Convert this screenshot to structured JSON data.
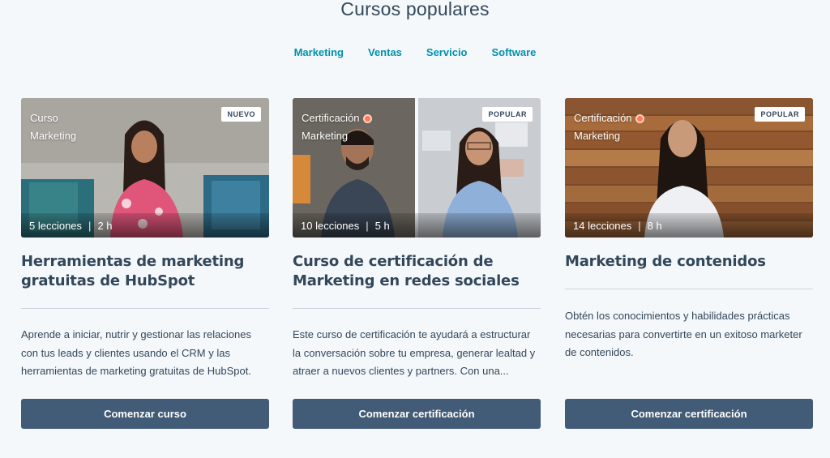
{
  "section": {
    "title": "Cursos populares"
  },
  "tabs": [
    {
      "label": "Marketing"
    },
    {
      "label": "Ventas"
    },
    {
      "label": "Servicio"
    },
    {
      "label": "Software"
    }
  ],
  "cards": [
    {
      "kind": "Curso",
      "category": "Marketing",
      "badge": "NUEVO",
      "lessons": "5 lecciones",
      "duration": "2 h",
      "title": "Herramientas de marketing gratuitas de HubSpot",
      "description": "Aprende a iniciar, nutrir y gestionar las relaciones con tus leads y clientes usando el CRM y las herramientas de marketing gratuitas de HubSpot.",
      "cta": "Comenzar curso"
    },
    {
      "kind": "Certificación",
      "category": "Marketing",
      "badge": "POPULAR",
      "lessons": "10 lecciones",
      "duration": "5 h",
      "title": "Curso de certificación de Marketing en redes sociales",
      "description": "Este curso de certificación te ayudará a estructurar la conversación sobre tu empresa, generar lealtad y atraer a nuevos clientes y partners. Con una...",
      "cta": "Comenzar certificación"
    },
    {
      "kind": "Certificación",
      "category": "Marketing",
      "badge": "POPULAR",
      "lessons": "14 lecciones",
      "duration": "8 h",
      "title": "Marketing de contenidos",
      "description": "Obtén los conocimientos y habilidades prácticas necesarias para convertirte en un exitoso marketer de contenidos.",
      "cta": "Comenzar certificación"
    }
  ],
  "colors": {
    "accent_tab": "#0091ae",
    "cta_bg": "#425b76",
    "text": "#33475b",
    "cert_icon": "#ff7a59"
  }
}
